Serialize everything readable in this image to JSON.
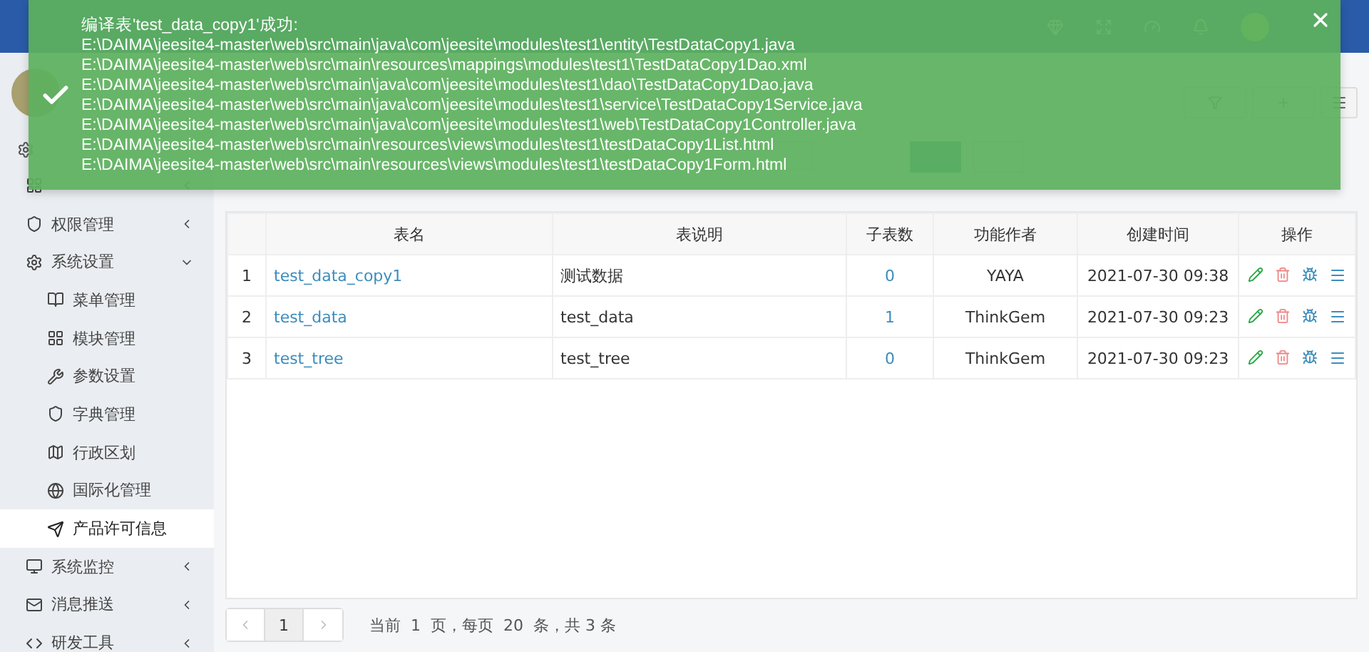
{
  "header": {
    "links": [
      {
        "kind": "brand"
      },
      {
        "kind": "fullscreen"
      },
      {
        "kind": "theme"
      },
      {
        "kind": "notice"
      }
    ]
  },
  "sidebar": {
    "items": [
      {
        "expanded": false,
        "selected": false
      },
      {
        "label": "权限管理",
        "expanded": false,
        "selected": false
      },
      {
        "label": "系统设置",
        "expanded": true,
        "selected": false,
        "children": [
          {
            "label": "菜单管理",
            "selected": false
          },
          {
            "label": "模块管理",
            "selected": false
          },
          {
            "label": "参数设置",
            "selected": false
          },
          {
            "label": "字典管理",
            "selected": false
          },
          {
            "label": "行政区划",
            "selected": false
          },
          {
            "label": "国际化管理",
            "selected": false
          },
          {
            "label": "产品许可信息",
            "selected": true
          }
        ]
      },
      {
        "label": "系统监控",
        "expanded": false,
        "selected": false
      },
      {
        "label": "消息推送",
        "expanded": false,
        "selected": false
      },
      {
        "label": "研发工具",
        "expanded": false,
        "selected": false
      }
    ]
  },
  "toolbar": {
    "buttons": [
      {
        "kind": "filter"
      },
      {
        "kind": "add"
      },
      {
        "kind": "menu"
      }
    ]
  },
  "search": {
    "buttons": [
      {
        "kind": "primary"
      },
      {
        "kind": "default"
      }
    ]
  },
  "table": {
    "columns": [
      "",
      "表名",
      "表说明",
      "子表数",
      "功能作者",
      "创建时间",
      "操作"
    ],
    "rows": [
      {
        "cells": [
          "1",
          "test_data_copy1",
          "测试数据",
          "0",
          "YAYA",
          "2021-07-30 09:38"
        ]
      },
      {
        "cells": [
          "2",
          "test_data",
          "test_data",
          "1",
          "ThinkGem",
          "2021-07-30 09:23"
        ]
      },
      {
        "cells": [
          "3",
          "test_tree",
          "test_tree",
          "0",
          "ThinkGem",
          "2021-07-30 09:23"
        ]
      }
    ]
  },
  "pagination": {
    "pages": [
      {
        "label": "1",
        "selected": true
      }
    ],
    "info": "当前  1  页，每页  20  条，共 3 条"
  },
  "toast": {
    "title": "编译表'test_data_copy1'成功:",
    "lines": [
      "E:\\DAIMA\\jeesite4-master\\web\\src\\main\\java\\com\\jeesite\\modules\\test1\\entity\\TestDataCopy1.java",
      "E:\\DAIMA\\jeesite4-master\\web\\src\\main\\resources\\mappings\\modules\\test1\\TestDataCopy1Dao.xml",
      "E:\\DAIMA\\jeesite4-master\\web\\src\\main\\java\\com\\jeesite\\modules\\test1\\dao\\TestDataCopy1Dao.java",
      "E:\\DAIMA\\jeesite4-master\\web\\src\\main\\java\\com\\jeesite\\modules\\test1\\service\\TestDataCopy1Service.java",
      "E:\\DAIMA\\jeesite4-master\\web\\src\\main\\java\\com\\jeesite\\modules\\test1\\web\\TestDataCopy1Controller.java",
      "E:\\DAIMA\\jeesite4-master\\web\\src\\main\\resources\\views\\modules\\test1\\testDataCopy1List.html",
      "E:\\DAIMA\\jeesite4-master\\web\\src\\main\\resources\\views\\modules\\test1\\testDataCopy1Form.html"
    ]
  }
}
